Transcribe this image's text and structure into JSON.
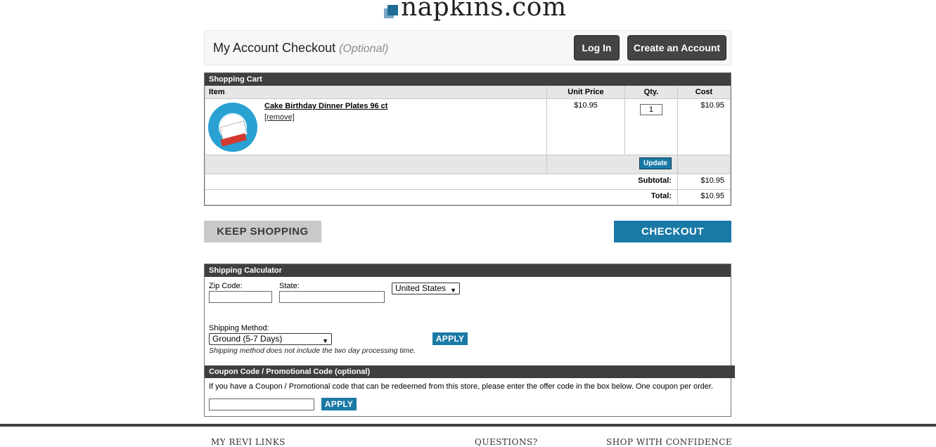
{
  "brand": {
    "name": "napkins.com"
  },
  "account": {
    "title": "My Account Checkout",
    "optional": "(Optional)",
    "login_label": "Log In",
    "create_label": "Create an Account"
  },
  "cart": {
    "header": "Shopping Cart",
    "columns": {
      "item": "Item",
      "unit_price": "Unit Price",
      "qty": "Qty.",
      "cost": "Cost"
    },
    "items": [
      {
        "name": "Cake Birthday Dinner Plates 96 ct",
        "remove": "[remove]",
        "unit_price": "$10.95",
        "qty": "1",
        "cost": "$10.95"
      }
    ],
    "update_label": "Update",
    "subtotal_label": "Subtotal:",
    "subtotal": "$10.95",
    "total_label": "Total:",
    "total": "$10.95"
  },
  "actions": {
    "keep_shopping": "KEEP SHOPPING",
    "checkout": "CHECKOUT"
  },
  "shipping": {
    "header": "Shipping Calculator",
    "zip_label": "Zip Code:",
    "state_label": "State:",
    "country": "United States",
    "method_label": "Shipping Method:",
    "method": "Ground (5-7 Days)",
    "apply_label": "APPLY",
    "note": "Shipping method does not include the two day processing time."
  },
  "coupon": {
    "header": "Coupon Code / Promotional Code (optional)",
    "text": "If you have a Coupon / Promotional code that can be redeemed from this store, please enter the offer code in the box below. One coupon per order.",
    "apply_label": "APPLY"
  },
  "footer": {
    "col1": "MY REVI  LINKS",
    "col2": "QUESTIONS?",
    "col3": "SHOP WITH CONFIDENCE"
  }
}
